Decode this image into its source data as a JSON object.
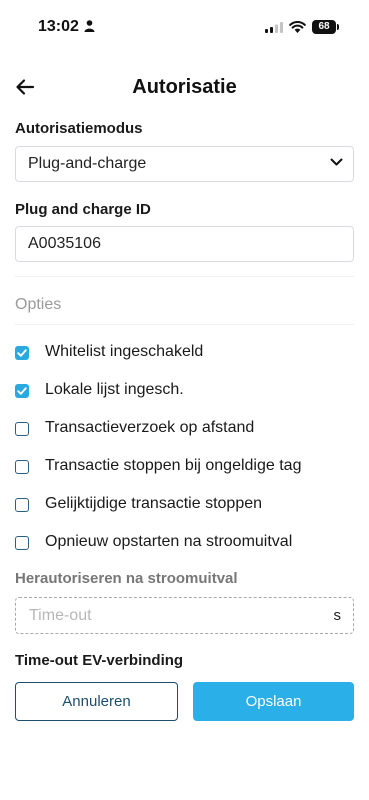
{
  "status_bar": {
    "time": "13:02",
    "battery": "68"
  },
  "header": {
    "title": "Autorisatie"
  },
  "auth_mode": {
    "label": "Autorisatiemodus",
    "value": "Plug-and-charge"
  },
  "plug_charge_id": {
    "label": "Plug and charge ID",
    "value": "A0035106"
  },
  "options": {
    "title": "Opties",
    "items": [
      {
        "label": "Whitelist ingeschakeld",
        "checked": true
      },
      {
        "label": "Lokale lijst ingesch.",
        "checked": true
      },
      {
        "label": "Transactieverzoek op afstand",
        "checked": false
      },
      {
        "label": "Transactie stoppen bij ongeldige tag",
        "checked": false
      },
      {
        "label": "Gelijktijdige transactie stoppen",
        "checked": false
      },
      {
        "label": "Opnieuw opstarten na stroomuitval",
        "checked": false
      }
    ]
  },
  "reauth": {
    "label": "Herautoriseren na stroomuitval",
    "placeholder": "Time-out",
    "unit": "s"
  },
  "ev_timeout": {
    "label": "Time-out EV-verbinding"
  },
  "buttons": {
    "cancel": "Annuleren",
    "save": "Opslaan"
  },
  "colors": {
    "accent": "#2aafe8",
    "navy": "#1e4d6e"
  }
}
